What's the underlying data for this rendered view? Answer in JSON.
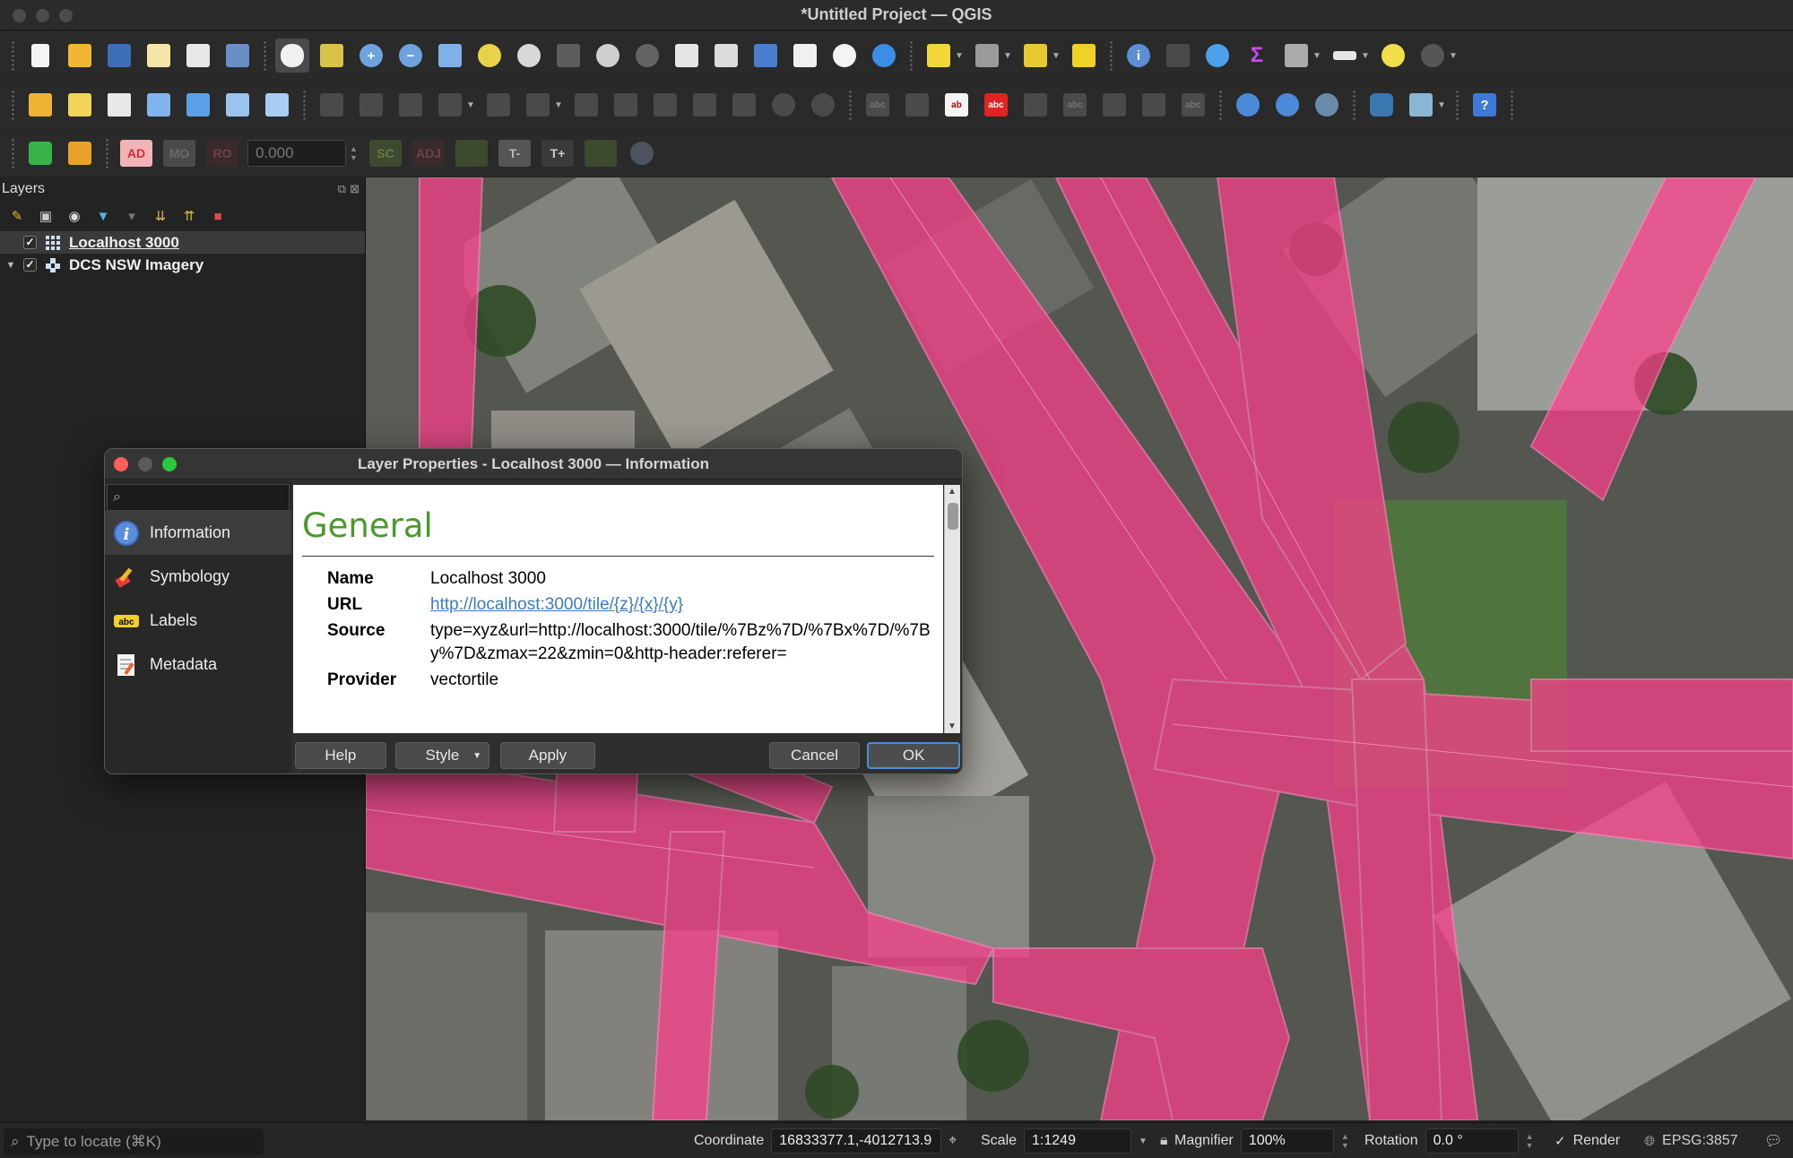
{
  "window": {
    "title": "*Untitled Project — QGIS"
  },
  "snapping": {
    "ad": "AD",
    "mo": "MO",
    "ro": "RO",
    "tolerance": "0.000",
    "sc": "SC",
    "adj": "ADJ",
    "tminus": "T-",
    "tplus": "T+"
  },
  "layers_panel": {
    "title": "Layers",
    "items": [
      {
        "name": "Localhost 3000",
        "checked": true,
        "icon": "grid-icon"
      },
      {
        "name": "DCS NSW Imagery",
        "checked": true,
        "icon": "raster-icon"
      }
    ]
  },
  "dialog": {
    "title": "Layer Properties - Localhost 3000 — Information",
    "search_value": "",
    "nav": [
      {
        "label": "Information",
        "icon": "info-icon"
      },
      {
        "label": "Symbology",
        "icon": "paintbrush-icon"
      },
      {
        "label": "Labels",
        "icon": "abc-label-icon"
      },
      {
        "label": "Metadata",
        "icon": "metadata-icon"
      }
    ],
    "section_title": "General",
    "fields": {
      "name_key": "Name",
      "name_val": "Localhost 3000",
      "url_key": "URL",
      "url_val": "http://localhost:3000/tile/{z}/{x}/{y}",
      "source_key": "Source",
      "source_val": "type=xyz&url=http://localhost:3000/tile/%7Bz%7D/%7Bx%7D/%7By%7D&zmax=22&zmin=0&http-header:referer=",
      "provider_key": "Provider",
      "provider_val": "vectortile"
    },
    "buttons": {
      "help": "Help",
      "style": "Style",
      "apply": "Apply",
      "cancel": "Cancel",
      "ok": "OK"
    }
  },
  "statusbar": {
    "locate_placeholder": "Type to locate (⌘K)",
    "coordinate_label": "Coordinate",
    "coordinate_value": "16833377.1,-4012713.9",
    "scale_label": "Scale",
    "scale_value": "1:1249",
    "magnifier_label": "Magnifier",
    "magnifier_value": "100%",
    "rotation_label": "Rotation",
    "rotation_value": "0.0 °",
    "render_label": "Render",
    "crs": "EPSG:3857"
  },
  "colors": {
    "road_overlay": "#ff3d8c",
    "section_title": "#4a9a2a",
    "link": "#3a7cc4",
    "ok_border": "#4a90d9"
  }
}
